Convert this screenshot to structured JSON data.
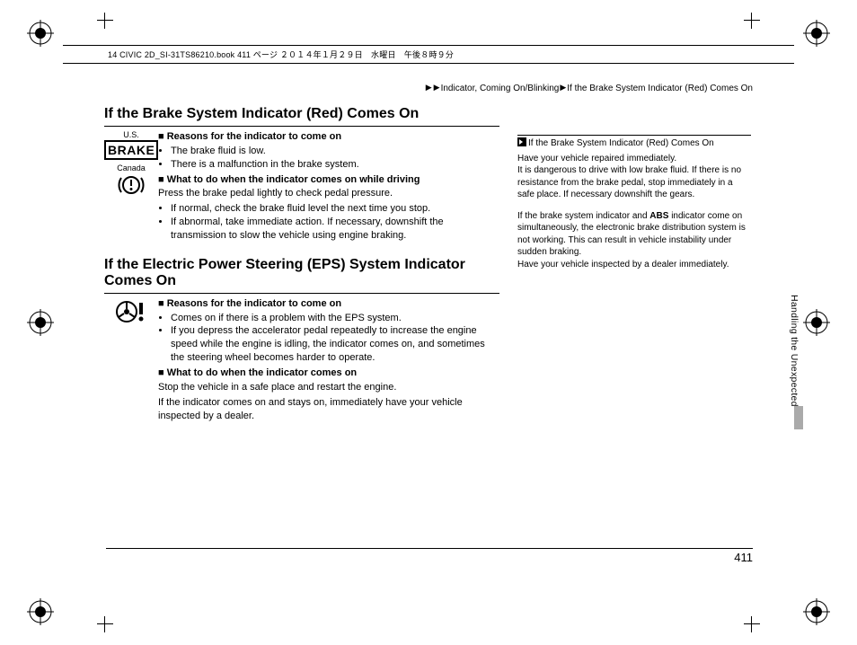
{
  "bookline": "14 CIVIC 2D_SI-31TS86210.book  411 ページ  ２０１４年１月２９日　水曜日　午後８時９分",
  "breadcrumb": {
    "tri": "▶",
    "seg1": "Indicator, Coming On/Blinking",
    "seg2": "If the Brake System Indicator (Red) Comes On"
  },
  "h1": "If the Brake System Indicator (Red) Comes On",
  "icons": {
    "us": "U.S.",
    "brake": "BRAKE",
    "canada": "Canada"
  },
  "s1": {
    "head1": "Reasons for the indicator to come on",
    "b1": "The brake fluid is low.",
    "b2": "There is a malfunction in the brake system.",
    "head2": "What to do when the indicator comes on while driving",
    "p1": "Press the brake pedal lightly to check pedal pressure.",
    "b3": "If normal, check the brake fluid level the next time you stop.",
    "b4": "If abnormal, take immediate action. If necessary, downshift the transmission to slow the vehicle using engine braking."
  },
  "h2": "If the Electric Power Steering (EPS) System Indicator Comes On",
  "s2": {
    "head1": "Reasons for the indicator to come on",
    "b1": "Comes on if there is a problem with the EPS system.",
    "b2": "If you depress the accelerator pedal repeatedly to increase the engine speed while the engine is idling, the indicator comes on, and sometimes the steering wheel becomes harder to operate.",
    "head2": "What to do when the indicator comes on",
    "p1": "Stop the vehicle in a safe place and restart the engine.",
    "p2": "If the indicator comes on and stays on, immediately have your vehicle inspected by a dealer."
  },
  "side": {
    "title": "If the Brake System Indicator (Red) Comes On",
    "p1": "Have your vehicle repaired immediately.",
    "p2": "It is dangerous to drive with low brake fluid. If there is no resistance from the brake pedal, stop immediately in a safe place. If necessary downshift the gears.",
    "p3a": "If the brake system indicator and ",
    "abs": "ABS",
    "p3b": " indicator come on simultaneously, the electronic brake distribution system is not working. This can result in vehicle instability under sudden braking.",
    "p4": "Have your vehicle inspected by a dealer immediately."
  },
  "tab": "Handling the Unexpected",
  "pagenum": "411"
}
